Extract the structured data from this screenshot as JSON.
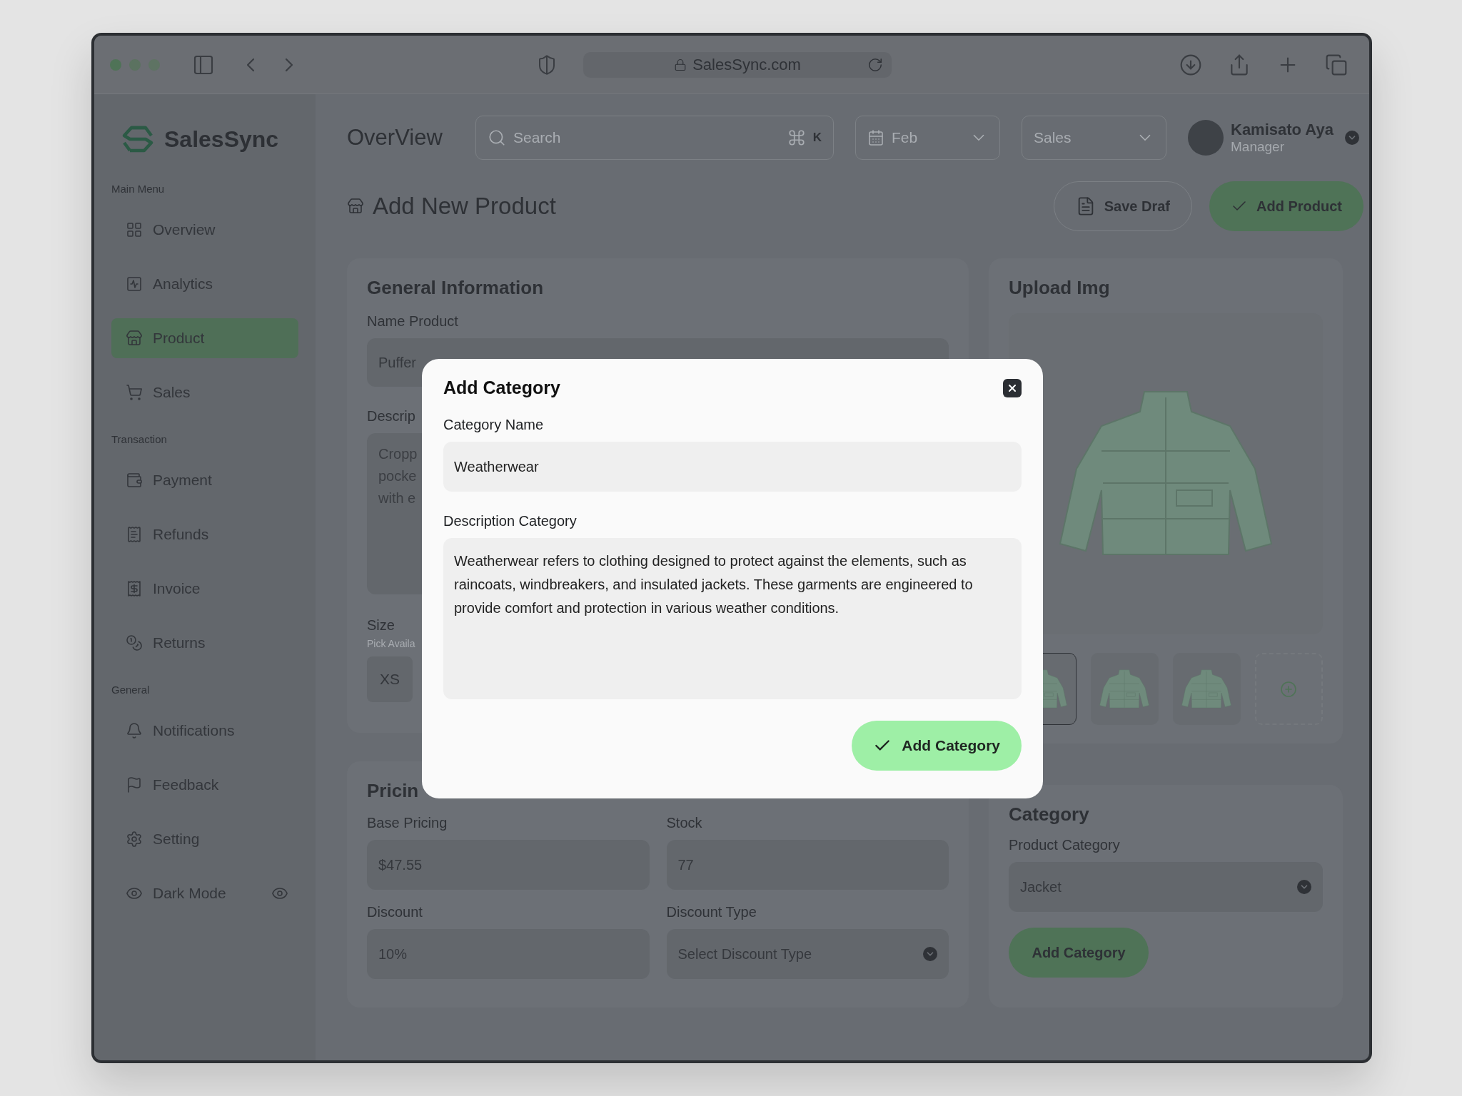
{
  "browser": {
    "url": "SalesSync.com"
  },
  "brand": {
    "name": "SalesSync"
  },
  "sidebar": {
    "sections": [
      {
        "title": "Main Menu",
        "items": [
          {
            "label": "Overview",
            "selected": false
          },
          {
            "label": "Analytics",
            "selected": false
          },
          {
            "label": "Product",
            "selected": true
          },
          {
            "label": "Sales",
            "selected": false
          }
        ]
      },
      {
        "title": "Transaction",
        "items": [
          {
            "label": "Payment",
            "selected": false
          },
          {
            "label": "Refunds",
            "selected": false
          },
          {
            "label": "Invoice",
            "selected": false
          },
          {
            "label": "Returns",
            "selected": false
          }
        ]
      },
      {
        "title": "General",
        "items": [
          {
            "label": "Notifications",
            "selected": false
          },
          {
            "label": "Feedback",
            "selected": false
          },
          {
            "label": "Setting",
            "selected": false
          },
          {
            "label": "Dark Mode",
            "selected": false
          }
        ]
      }
    ]
  },
  "header": {
    "title": "OverView",
    "search": {
      "placeholder": "Search",
      "shortcut": "K"
    },
    "month": {
      "placeholder": "Feb"
    },
    "type": {
      "placeholder": "Sales"
    },
    "user": {
      "name": "Kamisato Aya",
      "role": "Manager"
    }
  },
  "page": {
    "title": "Add New Product",
    "actions": [
      {
        "label": "Save Draf",
        "kind": "secondary"
      },
      {
        "label": "Add Product",
        "kind": "primary"
      }
    ]
  },
  "general": {
    "title": "General Information",
    "name_label": "Name Product",
    "name_value": "Puffer",
    "description_label": "Descrip",
    "description_lines": [
      "Cropp",
      "pocke",
      "with e"
    ],
    "size_label": "Size",
    "size_hint": "Pick Availa",
    "sizes": [
      "XS"
    ]
  },
  "pricing": {
    "title": "Pricin",
    "fields": [
      {
        "label": "Base Pricing",
        "value": "$47.55",
        "kind": "text"
      },
      {
        "label": "Stock",
        "value": "77",
        "kind": "text"
      },
      {
        "label": "Discount",
        "value": "10%",
        "kind": "text"
      },
      {
        "label": "Discount Type",
        "placeholder": "Select Discount Type",
        "kind": "select"
      }
    ]
  },
  "upload": {
    "title": "Upload Img",
    "thumbnails": [
      {
        "selected": true
      },
      {
        "selected": false
      },
      {
        "selected": false
      }
    ]
  },
  "category": {
    "title": "Category",
    "label": "Product Category",
    "value": "Jacket",
    "button": "Add Category"
  },
  "modal": {
    "title": "Add Category",
    "name_label": "Category Name",
    "name_value": "Weatherwear",
    "description_label": "Description Category",
    "description_value": "Weatherwear refers to clothing designed to protect against the elements, such as raincoats, windbreakers, and insulated jackets. These garments are engineered to provide comfort and protection in various weather conditions.",
    "submit": "Add Category"
  }
}
